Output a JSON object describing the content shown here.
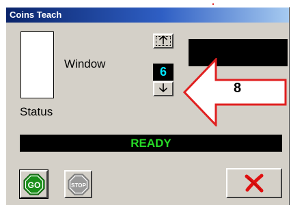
{
  "window": {
    "title": "Coins Teach"
  },
  "labels": {
    "window": "Window",
    "status": "Status"
  },
  "spinner": {
    "value": "6",
    "up_icon": "arrow-up-icon",
    "down_icon": "arrow-down-icon"
  },
  "callout": {
    "number": "8",
    "color": "#e02020"
  },
  "status": {
    "text": "READY",
    "color": "#26d926"
  },
  "buttons": {
    "go": {
      "label": "GO",
      "icon": "go-sign-icon",
      "color": "#1a8f1a"
    },
    "stop": {
      "label": "STOP",
      "icon": "stop-sign-icon",
      "color": "#9a9a9a"
    },
    "cancel": {
      "icon": "red-x-icon",
      "color": "#e01010"
    }
  }
}
